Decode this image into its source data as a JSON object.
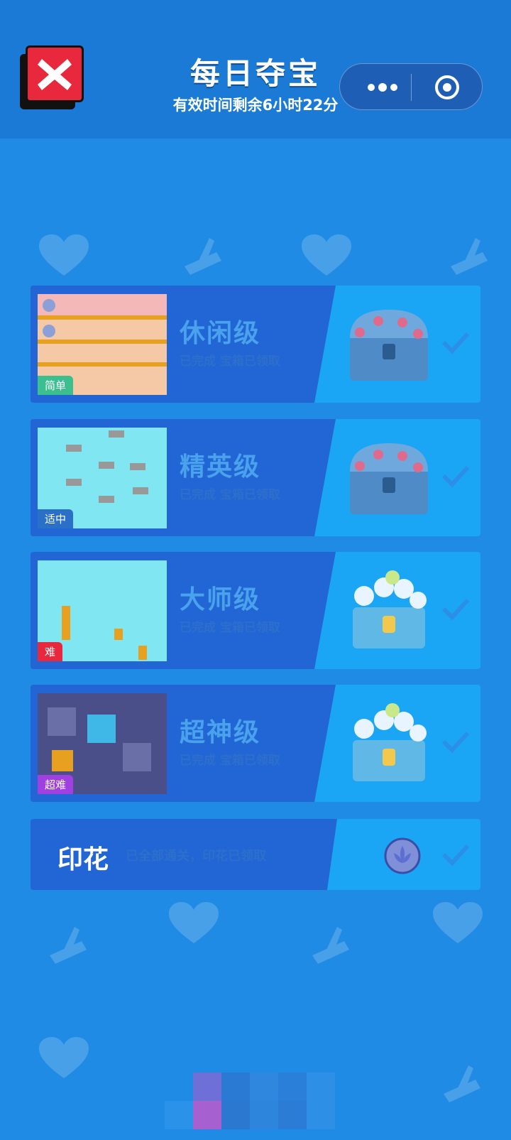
{
  "header": {
    "title": "每日夺宝",
    "subtitle": "有效时间剩余6小时22分",
    "close_icon": "close-icon",
    "more_icon": "more-dots-icon",
    "target_icon": "target-icon"
  },
  "levels": [
    {
      "title": "休闲级",
      "status": "已完成 宝箱已领取",
      "badge": "简单",
      "badge_color": "#3bbf8f",
      "chest": "blue-chest-icon"
    },
    {
      "title": "精英级",
      "status": "已完成 宝箱已领取",
      "badge": "适中",
      "badge_color": "#2a6fc8",
      "chest": "blue-chest-icon"
    },
    {
      "title": "大师级",
      "status": "已完成 宝箱已领取",
      "badge": "难",
      "badge_color": "#e8283c",
      "chest": "flower-chest-icon"
    },
    {
      "title": "超神级",
      "status": "已完成 宝箱已领取",
      "badge": "超难",
      "badge_color": "#a040e0",
      "chest": "flower-chest-icon"
    }
  ],
  "stamp": {
    "title": "印花",
    "status": "已全部通关，印花已领取",
    "icon": "lotus-stamp-icon"
  },
  "colors": {
    "background": "#1f8be4",
    "card_dark": "#2166d4",
    "card_light": "#1aa6f5"
  }
}
